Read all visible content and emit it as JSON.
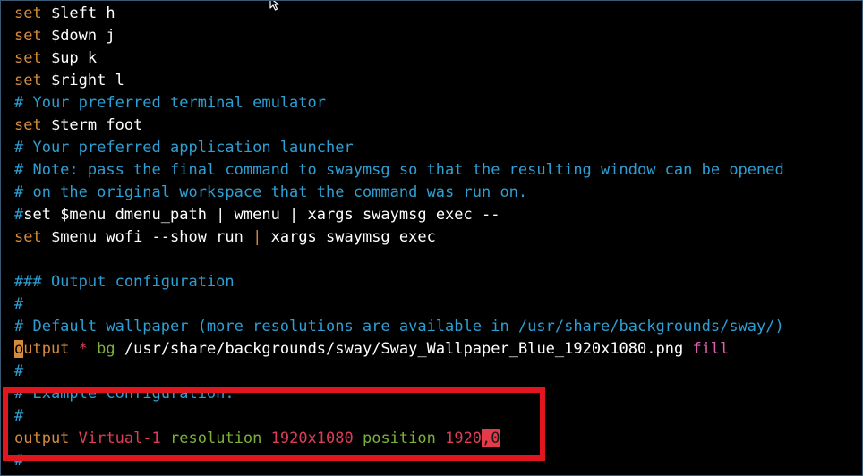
{
  "colors": {
    "keyword": "#d48b3b",
    "comment": "#2d9fd4",
    "operator": "#dc3d5a",
    "green": "#7cb13c",
    "magenta": "#dd5fb0",
    "highlight": "#e33b4b",
    "annotation_box": "#e1161f"
  },
  "icons": {
    "mouse_cursor": "mouse-pointer-icon"
  },
  "lines": {
    "l1": {
      "kw": "set",
      "rest": " $left h"
    },
    "l2": {
      "kw": "set",
      "rest": " $down j"
    },
    "l3": {
      "kw": "set",
      "rest": " $up k"
    },
    "l4": {
      "kw": "set",
      "rest": " $right l"
    },
    "l5": {
      "comment": "# Your preferred terminal emulator"
    },
    "l6": {
      "kw": "set",
      "rest": " $term foot"
    },
    "l7": {
      "comment": "# Your preferred application launcher"
    },
    "l8": {
      "comment": "# Note: pass the final command to swaymsg so that the resulting window can be opened"
    },
    "l9": {
      "comment": "# on the original workspace that the command was run on."
    },
    "l10": {
      "comment_hash": "#",
      "rest": "set $menu dmenu_path | wmenu | xargs swaymsg exec --"
    },
    "l11": {
      "kw": "set",
      "rest_a": " $menu wofi --show run ",
      "pipe": "|",
      "rest_b": " xargs swaymsg exec"
    },
    "l12": {
      "text": ""
    },
    "l13": {
      "comment": "### Output configuration"
    },
    "l14": {
      "comment": "#"
    },
    "l15": {
      "comment": "# Default wallpaper (more resolutions are available in /usr/share/backgrounds/sway/)"
    },
    "l16": {
      "cursor_char": "o",
      "kw_rest": "utput",
      "star": " * ",
      "bg": "bg",
      "path": " /usr/share/backgrounds/sway/Sway_Wallpaper_Blue_1920x1080",
      "ext": ".png",
      "fill": " fill"
    },
    "l17": {
      "comment": "#"
    },
    "l18": {
      "comment": "# Example configuration:"
    },
    "l19": {
      "comment": "#"
    },
    "l20": {
      "kw": "output",
      "name": " Virtual-1",
      "res_kw": " resolution",
      "res": " 1920x1080",
      "pos_kw": " position",
      "pos_x": " 1920",
      "comma": ",",
      "pos_y": "0"
    },
    "l21": {
      "comment": "#"
    }
  }
}
